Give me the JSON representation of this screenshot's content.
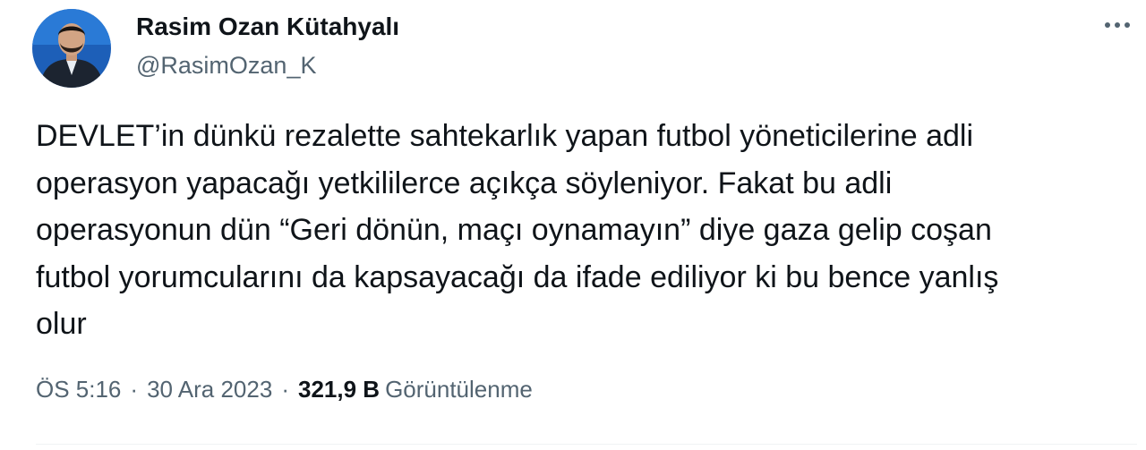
{
  "author": {
    "display_name": "Rasim Ozan Kütahyalı",
    "handle": "@RasimOzan_K"
  },
  "more_icon": "more-horizontal-icon",
  "tweet": {
    "lines": [
      "DEVLET’in dünkü rezalette sahtekarlık yapan futbol yöneticilerine adli",
      "operasyon yapacağı yetkililerce açıkça söyleniyor. Fakat bu adli",
      "operasyonun dün “Geri dönün, maçı oynamayın” diye gaza gelip coşan",
      "futbol yorumcularını da kapsayacağı da ifade ediliyor ki bu bence yanlış",
      "olur"
    ]
  },
  "meta": {
    "time": "ÖS 5:16",
    "separator": "·",
    "date": "30 Ara 2023",
    "views_count": "321,9 B",
    "views_label": "Görüntülenme"
  },
  "colors": {
    "text_primary": "#0f1419",
    "text_secondary": "#536471",
    "divider": "#eff3f4"
  }
}
